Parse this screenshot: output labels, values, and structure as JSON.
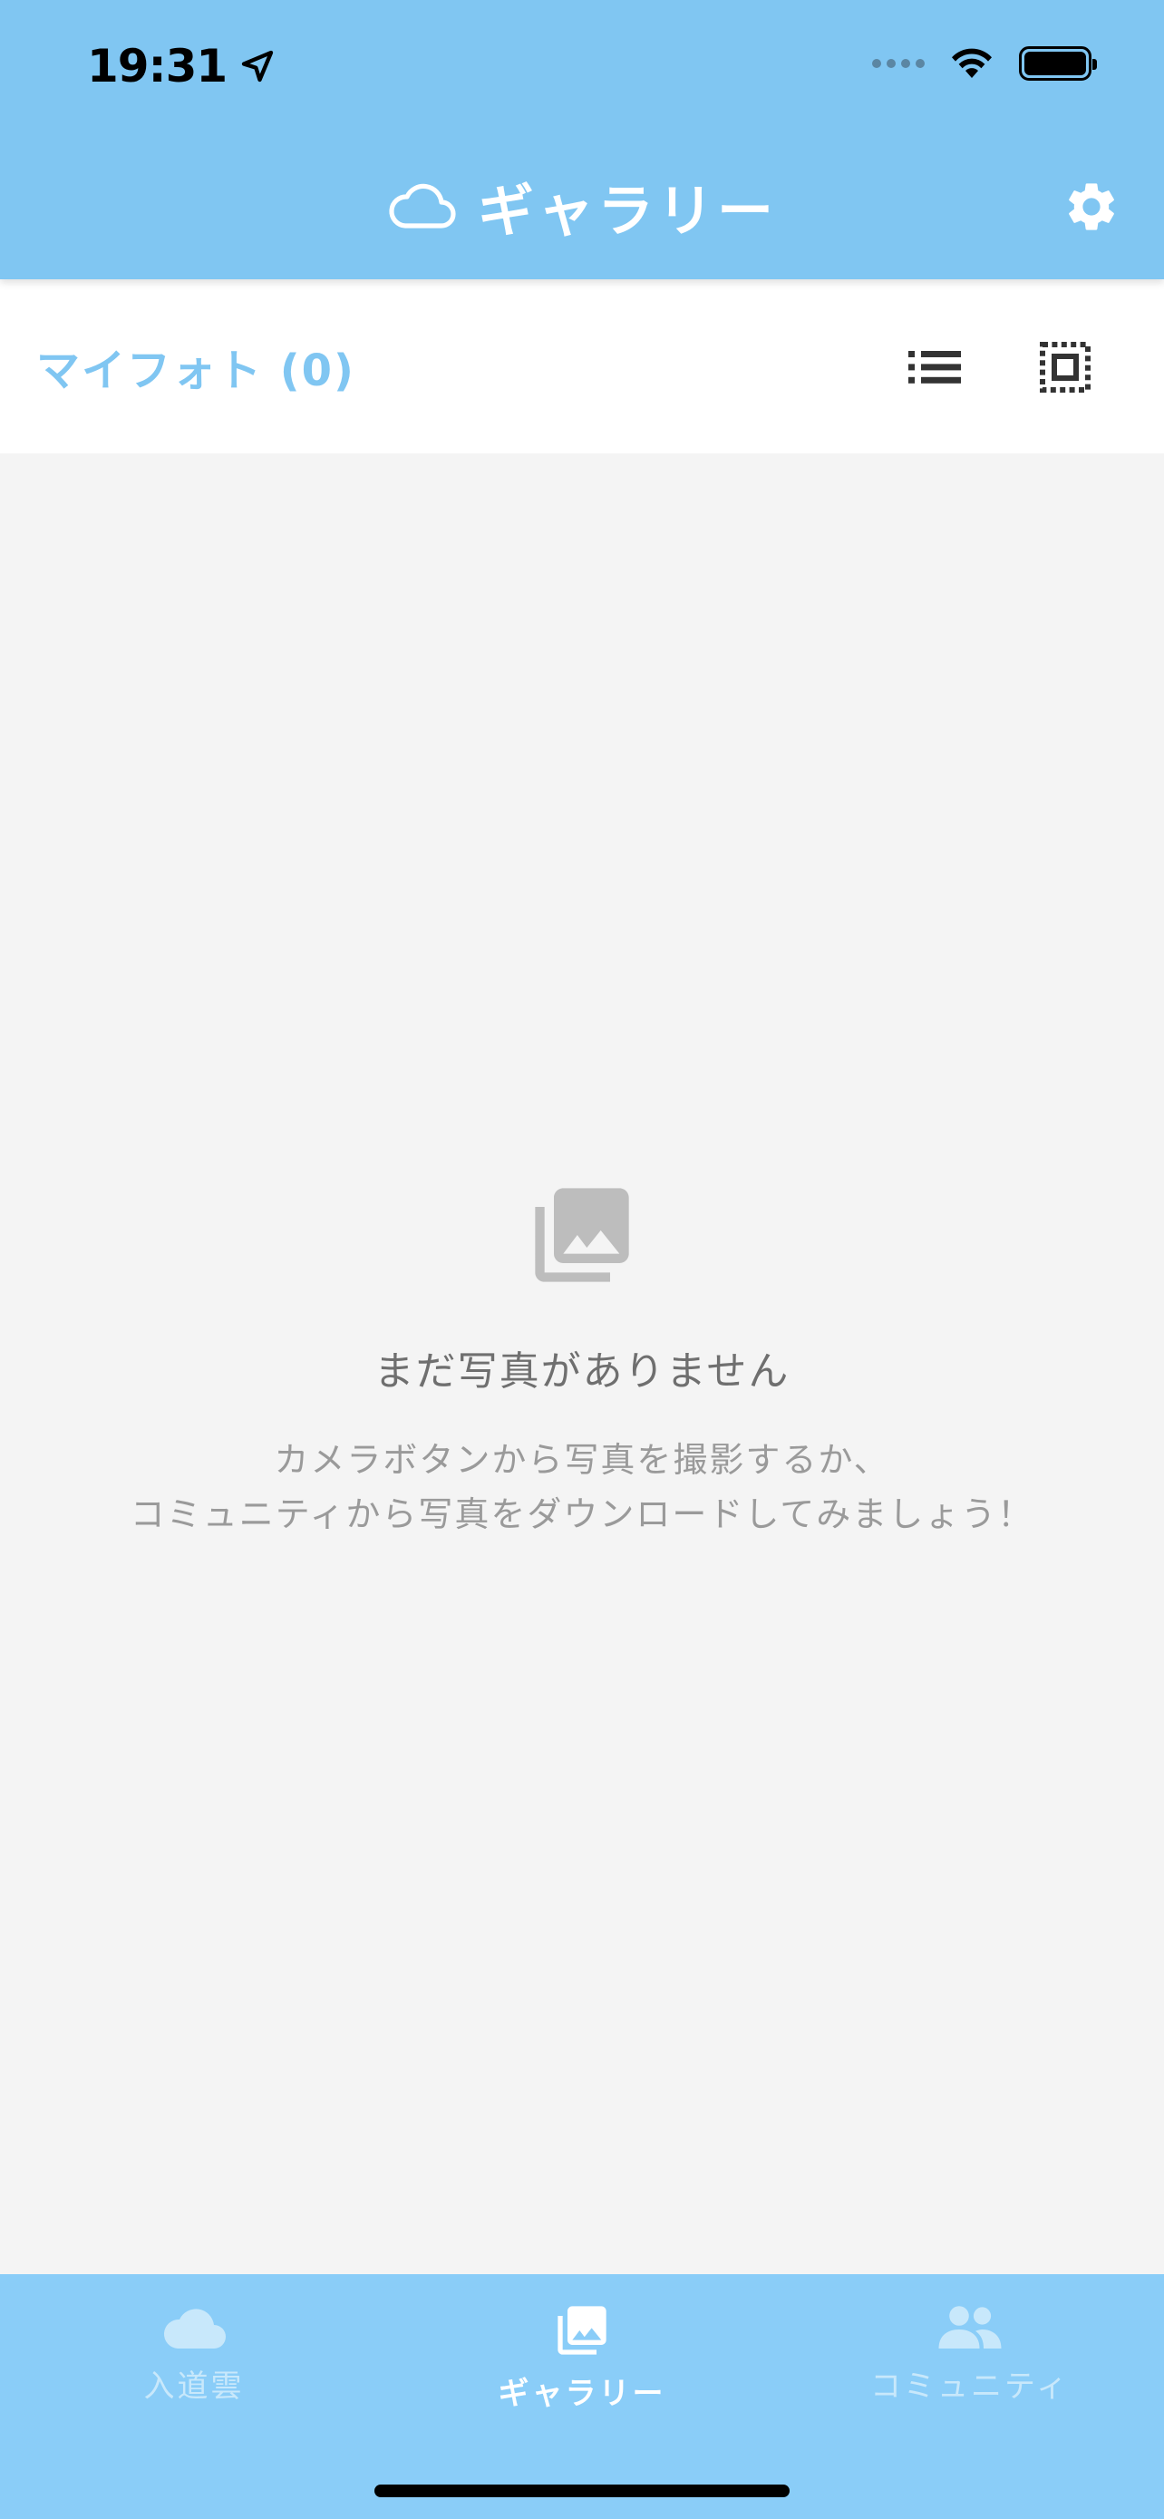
{
  "status_bar": {
    "time": "19:31"
  },
  "header": {
    "title": "ギャラリー"
  },
  "toolbar": {
    "my_photos_label": "マイフォト (0)"
  },
  "empty_state": {
    "title": "まだ写真がありません",
    "message": "カメラボタンから写真を撮影するか、\nコミュニティから写真をダウンロードしてみましょう！"
  },
  "tabs": [
    {
      "label": "入道雲",
      "icon": "cloud-icon",
      "active": false
    },
    {
      "label": "ギャラリー",
      "icon": "photo-library-icon",
      "active": true
    },
    {
      "label": "コミュニティ",
      "icon": "people-icon",
      "active": false
    }
  ],
  "colors": {
    "header": "#80c6f2",
    "tabbar": "#8acdf8",
    "accent": "#80c6f2",
    "background": "#f4f4f4"
  }
}
